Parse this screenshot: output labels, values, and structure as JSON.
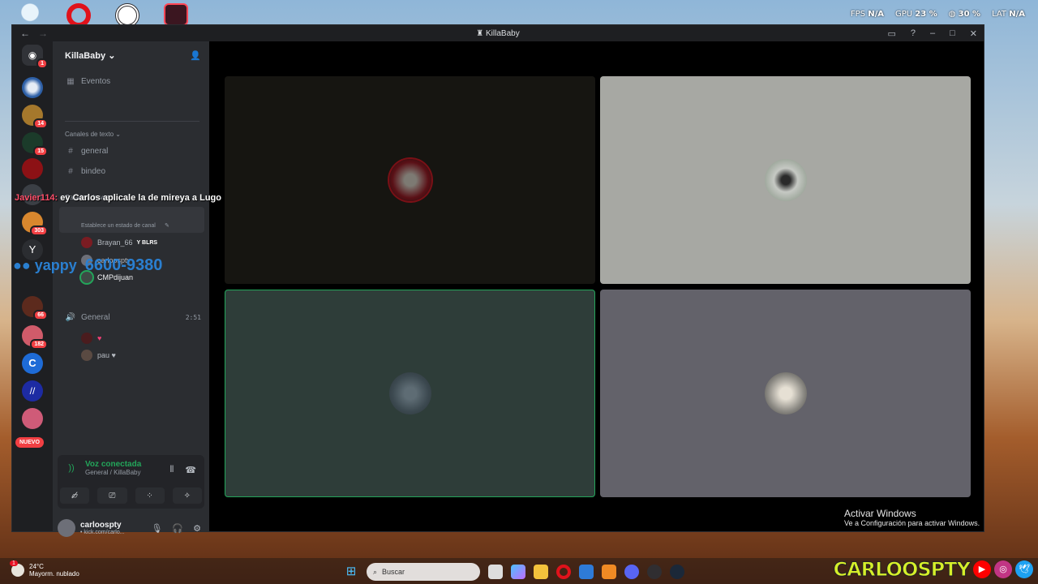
{
  "desktop": {
    "top_icons": [
      "recycle-bin-icon",
      "opera-icon",
      "obs-icon",
      "valorant-icon"
    ],
    "overlay": {
      "fps_label": "FPS",
      "fps_value": "N/A",
      "gpu_label": "GPU",
      "gpu_value": "23 %",
      "cpu_value": "30 %",
      "lat_label": "LAT",
      "lat_value": "N/A"
    }
  },
  "window": {
    "title": "KillaBaby",
    "back": "←",
    "forward": "→"
  },
  "rail": {
    "dm_badge": "1",
    "badges": [
      "14",
      "15",
      "303",
      "66",
      "182"
    ],
    "new_label": "NUEVO"
  },
  "sidebar": {
    "server_name": "KillaBaby",
    "events": "Eventos",
    "text_category": "Canales de texto",
    "text_channels": [
      "general",
      "bindeo"
    ],
    "voice_category": "Canales de voz",
    "channel_status_hint": "Establece un estado de canal",
    "voice_users_1": [
      {
        "name": "Brayan_66",
        "tag": "BLRS"
      },
      {
        "name": "carloospty",
        "tag": ""
      },
      {
        "name": "CMPdijuan",
        "tag": ""
      }
    ],
    "general_voice": "General",
    "general_time": "2:51",
    "voice_users_2": [
      {
        "name": "♥"
      },
      {
        "name": "pau ♥"
      }
    ]
  },
  "voice_panel": {
    "title": "Voz conectada",
    "subtitle": "General / KillaBaby"
  },
  "user_panel": {
    "name": "carloospty",
    "status": "• kick.com/carlo..."
  },
  "tiles": [
    {
      "bg": "#161511",
      "speaking": false
    },
    {
      "bg": "#a7a8a3",
      "speaking": false
    },
    {
      "bg": "#2e3d39",
      "speaking": true
    },
    {
      "bg": "#63626a",
      "speaking": false
    }
  ],
  "stream_overlays": {
    "chat_name": "Javier114:",
    "chat_text": " ey Carlos aplicale la de mireya a Lugo",
    "yappy_label": "yappy",
    "yappy_number": "6600-9380"
  },
  "activate_windows": {
    "title": "Activar Windows",
    "subtitle": "Ve a Configuración para activar Windows."
  },
  "taskbar": {
    "temp": "24°C",
    "weather": "Mayorm. nublado",
    "search_placeholder": "Buscar"
  },
  "brand": {
    "text": "CARLOOSPTY"
  },
  "colors": {
    "accent_green": "#23a55a",
    "bg_dark": "#1e1f22",
    "sidebar": "#2b2d31"
  }
}
